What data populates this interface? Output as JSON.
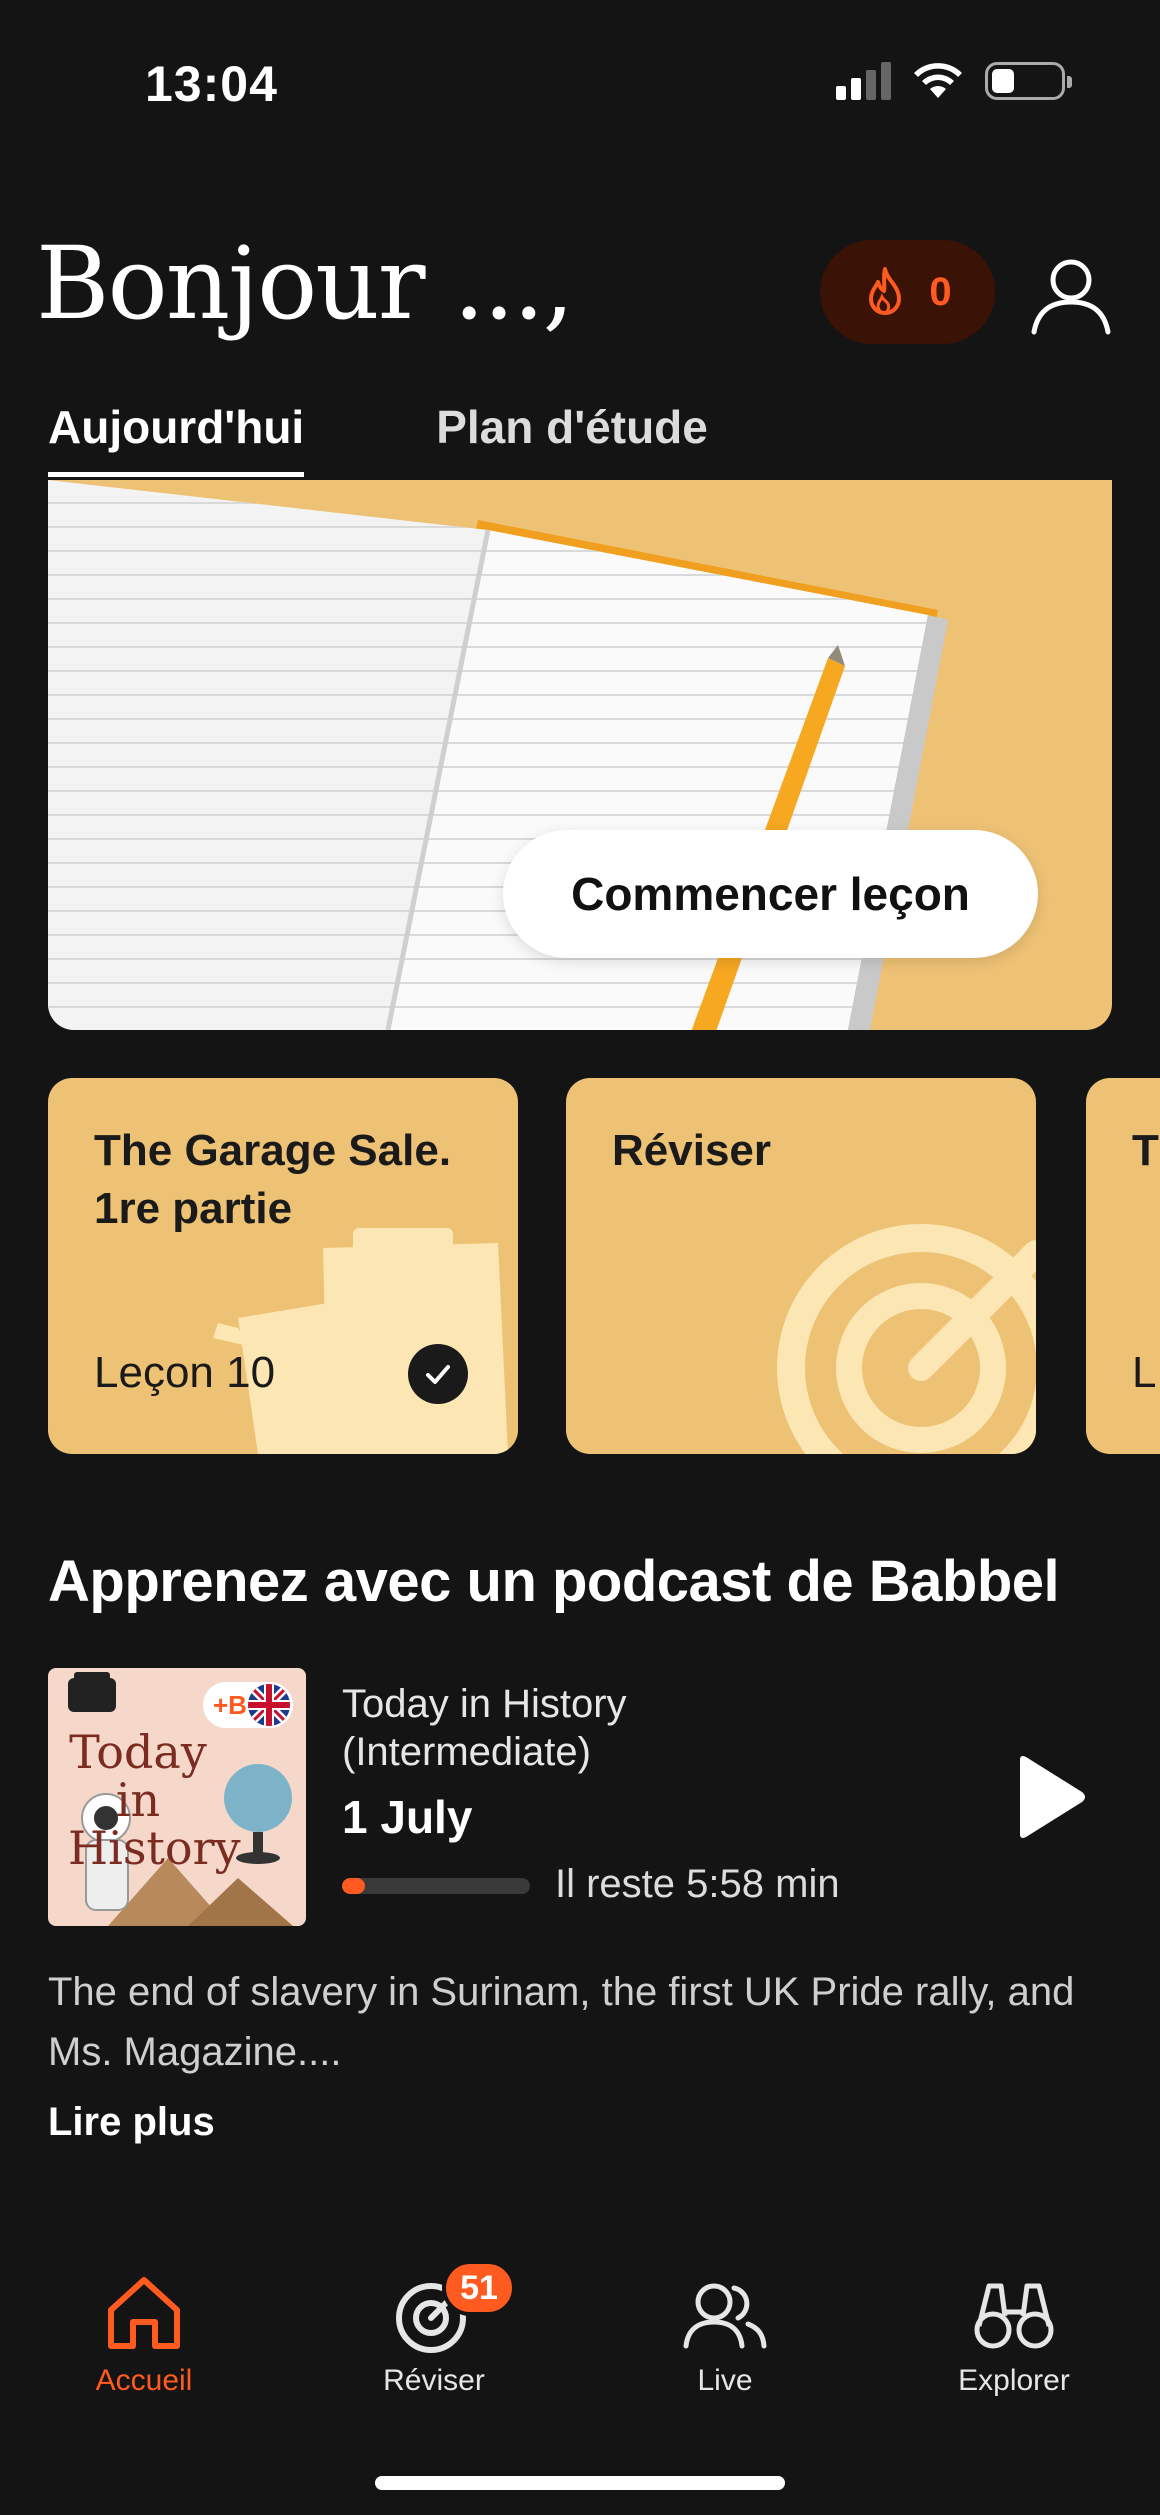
{
  "status_bar": {
    "time": "13:04",
    "icons": [
      "signal-icon",
      "wifi-icon",
      "battery-icon"
    ]
  },
  "header": {
    "greeting": "Bonjour ...,",
    "streak_count": "0",
    "streak_icon": "flame-icon",
    "profile_icon": "user-icon"
  },
  "tabs": [
    {
      "label": "Aujourd'hui",
      "active": true
    },
    {
      "label": "Plan d'étude",
      "active": false
    }
  ],
  "hero": {
    "button_label": "Commencer leçon"
  },
  "cards": [
    {
      "title": "The Garage Sale. 1re partie",
      "subtitle": "Leçon 10",
      "completed": true
    },
    {
      "title": "Réviser",
      "subtitle": ""
    },
    {
      "title": "T S",
      "subtitle": "L"
    }
  ],
  "podcast": {
    "section_title": "Apprenez avec un podcast de Babbel",
    "cover_title": "Today in History",
    "cover_badge": "+B",
    "series": "Today in History (Intermediate)",
    "episode": "1 July",
    "progress": 0.12,
    "remaining": "Il reste 5:58 min",
    "description": "The end of slavery in Surinam, the first UK Pride rally, and Ms. Magazine....",
    "read_more": "Lire plus"
  },
  "nav": [
    {
      "label": "Accueil",
      "icon": "home-icon",
      "active": true
    },
    {
      "label": "Réviser",
      "icon": "target-icon",
      "badge": "51"
    },
    {
      "label": "Live",
      "icon": "people-icon"
    },
    {
      "label": "Explorer",
      "icon": "binoculars-icon"
    }
  ],
  "colors": {
    "accent": "#ff5a1f",
    "card": "#eec275",
    "background": "#141414"
  }
}
